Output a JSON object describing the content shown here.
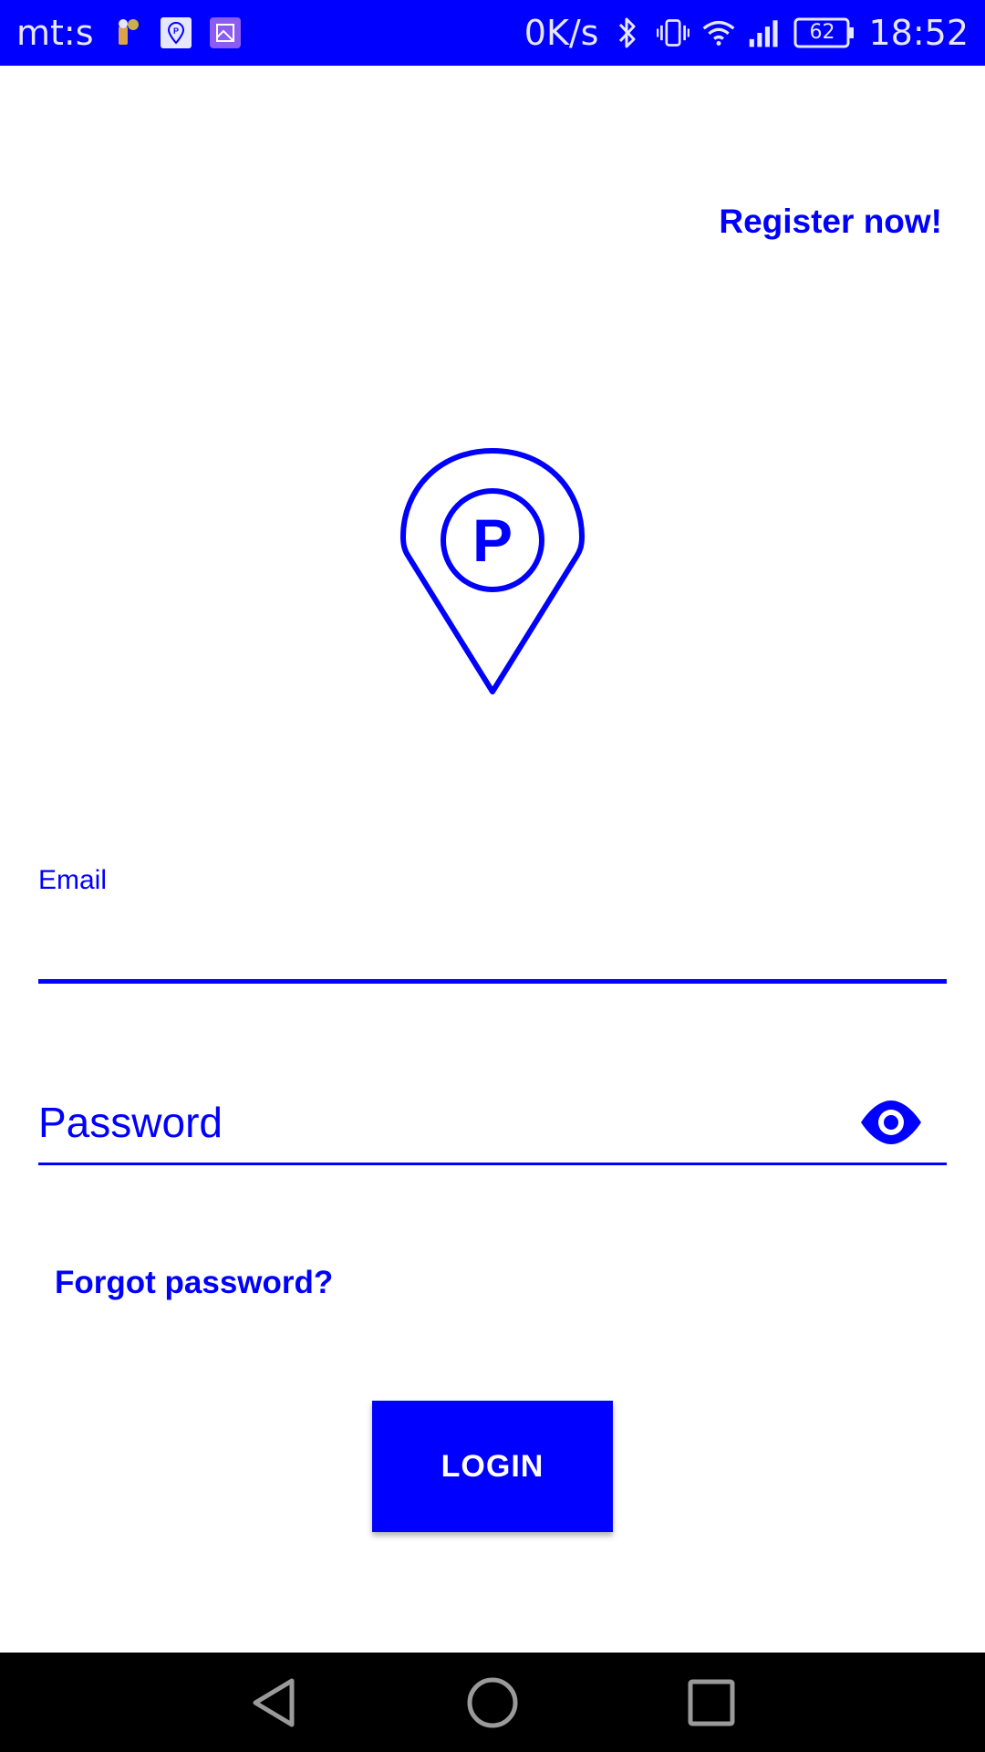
{
  "status_bar": {
    "carrier": "mt:s",
    "network_speed": "0K/s",
    "battery_level": "62",
    "time": "18:52",
    "icons": [
      "figure-icon",
      "parking-app-icon",
      "gallery-icon",
      "bluetooth-icon",
      "vibrate-icon",
      "wifi-icon",
      "signal-icon",
      "battery-icon"
    ]
  },
  "header": {
    "register_label": "Register now!"
  },
  "logo": {
    "icon": "parking-pin-icon",
    "letter": "P"
  },
  "form": {
    "email_label": "Email",
    "email_value": "",
    "password_placeholder": "Password",
    "password_value": "",
    "eye_icon": "eye-icon"
  },
  "links": {
    "forgot_password": "Forgot password?"
  },
  "actions": {
    "login_label": "LOGIN"
  },
  "nav_bar": {
    "buttons": [
      "back-icon",
      "home-icon",
      "recents-icon"
    ]
  },
  "colors": {
    "accent": "#0000ff",
    "background": "#ffffff",
    "nav_bar": "#000000",
    "button_text": "#ffffff"
  }
}
